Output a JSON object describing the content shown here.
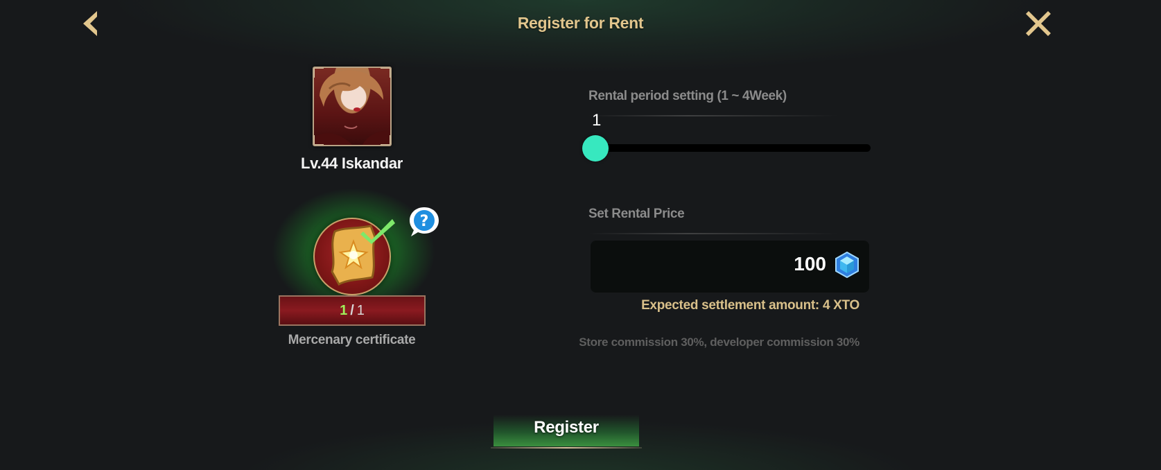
{
  "header": {
    "title": "Register for Rent",
    "back_icon": "chevron-left-icon",
    "close_icon": "close-icon"
  },
  "character": {
    "name": "Lv.44 Iskandar"
  },
  "certificate": {
    "current": "1",
    "separator": "/",
    "max": "1",
    "label": "Mercenary certificate"
  },
  "rental_period": {
    "label": "Rental period setting (1 ~ 4Week)",
    "value": "1",
    "min": 1,
    "max": 4,
    "current": 1
  },
  "rental_price": {
    "label": "Set Rental Price",
    "value": "100",
    "currency_icon": "gem-icon"
  },
  "settlement": {
    "expected": "Expected settlement amount: 4 XTO",
    "commission": "Store commission 30%,  developer commission 30%"
  },
  "actions": {
    "register_label": "Register"
  },
  "colors": {
    "title_gold": "#e2c68d",
    "slider_thumb": "#37e8bf",
    "cert_count_green": "#9ff05a",
    "settlement_gold": "#d9c08a"
  }
}
